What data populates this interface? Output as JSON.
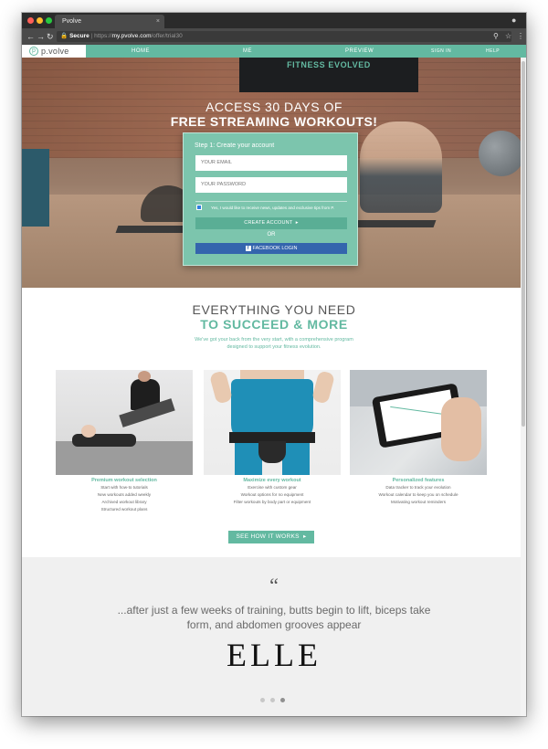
{
  "browser": {
    "tab_title": "Pvolve",
    "tab_close": "×",
    "url_secure": "Secure",
    "url_scheme": "https://",
    "url_host": "my.pvolve.com",
    "url_path": "/offer/trial30"
  },
  "site": {
    "logo_text": "p.volve",
    "nav": [
      "HOME",
      "ME",
      "PREVIEW"
    ],
    "sign_in": "SIGN IN",
    "help": "HELP"
  },
  "hero": {
    "tv_text": "FITNESS EVOLVED",
    "title_line1": "ACCESS 30 DAYS OF",
    "title_line2": "FREE STREAMING WORKOUTS!",
    "form": {
      "step_label": "Step 1: Create your account",
      "email_placeholder": "YOUR EMAIL",
      "password_placeholder": "YOUR PASSWORD",
      "newsletter_label": "Yes, I would like to receive news, updates and exclusive tips from P.",
      "newsletter_checked": true,
      "create_button": "CREATE ACCOUNT",
      "or_text": "OR",
      "facebook_button": "FACEBOOK LOGIN"
    }
  },
  "features": {
    "heading_line1": "EVERYTHING YOU NEED",
    "heading_line2": "TO SUCCEED & MORE",
    "subtitle_line1": "We've got your back from the very start, with a comprehensive program",
    "subtitle_line2": "designed to support your fitness evolution.",
    "columns": [
      {
        "title": "Premium workout selection",
        "items": [
          "Start with how-to tutorials",
          "New workouts added weekly",
          "Archived workout library",
          "Structured workout plans"
        ]
      },
      {
        "title": "Maximize every workout",
        "items": [
          "Exercise with custom gear",
          "Workout options for no equipment",
          "Filter workouts by body part or equipment"
        ]
      },
      {
        "title": "Personalized features",
        "items": [
          "Data tracker to track your evolution",
          "Workout calendar to keep you on schedule",
          "Motivating workout reminders"
        ]
      }
    ],
    "cta_button": "SEE HOW IT WORKS"
  },
  "testimonial": {
    "quote_mark": "“",
    "quote_line1": "...after just a few weeks of training, butts begin to lift, biceps take",
    "quote_line2": "form, and abdomen grooves appear",
    "source": "ELLE",
    "slides_total": 3,
    "active_slide": 3
  },
  "colors": {
    "brand_green": "#63b9a1",
    "form_green": "#7cc5ad",
    "facebook_blue": "#3465ad"
  }
}
